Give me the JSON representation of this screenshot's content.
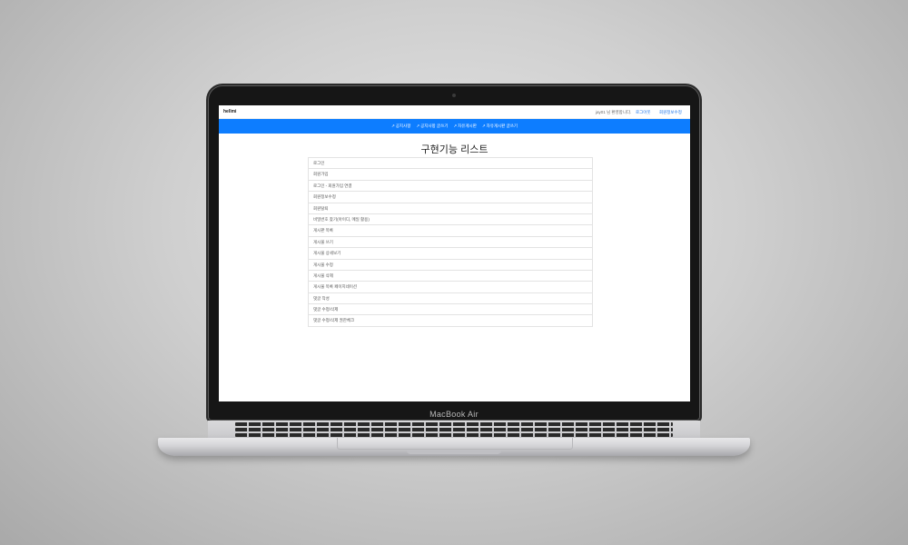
{
  "device": {
    "model_label": "MacBook Air"
  },
  "topbar": {
    "brand": "hellmi",
    "user_greeting": "jay01 님 환영합니다.",
    "logout_label": "로그아웃",
    "edit_profile_label": "회원정보수정"
  },
  "navbar": {
    "items": [
      {
        "label": "공지사항",
        "icon": "chart-icon"
      },
      {
        "label": "공지사항 글쓰기",
        "icon": "chart-icon"
      },
      {
        "label": "자유게시판",
        "icon": "chart-icon"
      },
      {
        "label": "자유게시판 글쓰기",
        "icon": "chart-icon"
      }
    ]
  },
  "main": {
    "title": "구현기능 리스트",
    "features": [
      "로그인",
      "회원가입",
      "로그인 - 회원가입 연결",
      "회원정보수정",
      "회원탈퇴",
      "비밀번호 찾기(아이디, 메일 활용)",
      "게시판 목록",
      "게시물 쓰기",
      "게시물 상세보기",
      "게시물 수정",
      "게시물 삭제",
      "게시물 목록 페이지네이션",
      "댓글 작성",
      "댓글 수정/삭제",
      "댓글 수정/삭제 권한체크"
    ]
  },
  "colors": {
    "nav_bg": "#0d7dff",
    "link": "#1a73e8"
  }
}
